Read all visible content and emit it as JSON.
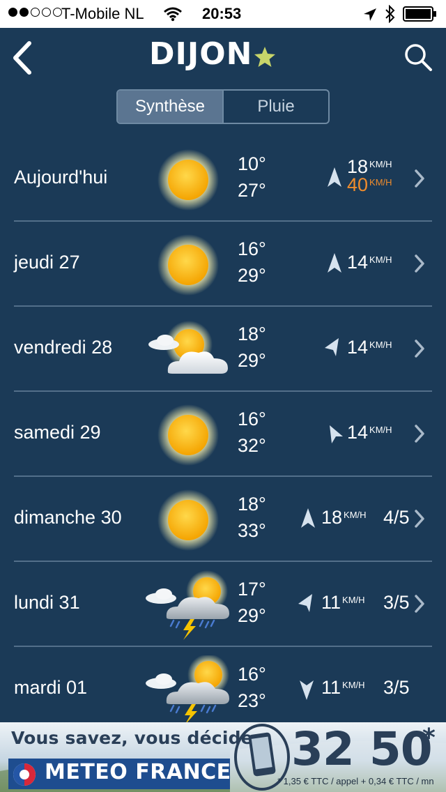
{
  "status_bar": {
    "carrier": "T-Mobile NL",
    "time": "20:53",
    "signal_bars_filled": 2,
    "signal_bars_total": 5
  },
  "header": {
    "city": "DIJON",
    "favorite": true,
    "star_color": "#c8d56a"
  },
  "tabs": [
    {
      "label": "Synthèse",
      "active": true
    },
    {
      "label": "Pluie",
      "active": false
    }
  ],
  "forecast": [
    {
      "day": "Aujourd'hui",
      "icon": "sun-icon",
      "temp_min": "10°",
      "temp_max": "27°",
      "wind": "18",
      "wind_unit": "KM/H",
      "gust": "40",
      "gust_unit": "KM/H",
      "confidence": "",
      "wind_dir": "north",
      "has_chevron": true
    },
    {
      "day": "jeudi 27",
      "icon": "sun-icon",
      "temp_min": "16°",
      "temp_max": "29°",
      "wind": "14",
      "wind_unit": "KM/H",
      "gust": "",
      "confidence": "",
      "wind_dir": "north",
      "has_chevron": true
    },
    {
      "day": "vendredi 28",
      "icon": "sun-cloud-icon",
      "temp_min": "18°",
      "temp_max": "29°",
      "wind": "14",
      "wind_unit": "KM/H",
      "gust": "",
      "confidence": "",
      "wind_dir": "north-east",
      "has_chevron": true
    },
    {
      "day": "samedi 29",
      "icon": "sun-icon",
      "temp_min": "16°",
      "temp_max": "32°",
      "wind": "14",
      "wind_unit": "KM/H",
      "gust": "",
      "confidence": "",
      "wind_dir": "north-west",
      "has_chevron": true
    },
    {
      "day": "dimanche 30",
      "icon": "sun-icon",
      "temp_min": "18°",
      "temp_max": "33°",
      "wind": "18",
      "wind_unit": "KM/H",
      "gust": "",
      "confidence": "4/5",
      "wind_dir": "north",
      "has_chevron": true
    },
    {
      "day": "lundi 31",
      "icon": "storm-icon",
      "temp_min": "17°",
      "temp_max": "29°",
      "wind": "11",
      "wind_unit": "KM/H",
      "gust": "",
      "confidence": "3/5",
      "wind_dir": "north-east",
      "has_chevron": true
    },
    {
      "day": "mardi 01",
      "icon": "storm-icon",
      "temp_min": "16°",
      "temp_max": "23°",
      "wind": "11",
      "wind_unit": "KM/H",
      "gust": "",
      "confidence": "3/5",
      "wind_dir": "south",
      "has_chevron": false
    }
  ],
  "ad": {
    "slogan": "Vous savez, vous décidez",
    "brand": "METEO FRANCE",
    "phone": "32 50",
    "asterisk": "*",
    "pricing": "* 1,35 € TTC / appel + 0,34 € TTC / mn"
  },
  "colors": {
    "background": "#1b3a57",
    "gust": "#f08c2c",
    "divider": "#7a93ab",
    "segment_active": "#5b7591"
  }
}
